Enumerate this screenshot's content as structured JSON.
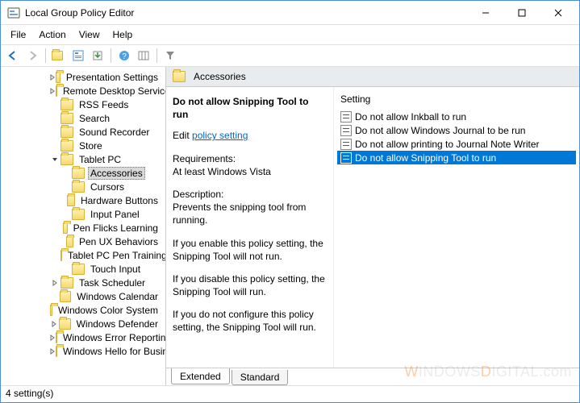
{
  "window": {
    "title": "Local Group Policy Editor"
  },
  "menu": {
    "items": [
      "File",
      "Action",
      "View",
      "Help"
    ]
  },
  "toolbar": {
    "back": "back-icon",
    "forward": "forward-icon",
    "up": "up-folder-icon",
    "props": "properties-icon",
    "export": "export-icon",
    "help": "help-icon",
    "cols": "columns-icon",
    "filter": "filter-icon"
  },
  "tree": {
    "items": [
      {
        "label": "Presentation Settings",
        "depth": 4,
        "toggle": ">"
      },
      {
        "label": "Remote Desktop Services",
        "depth": 4,
        "toggle": ">"
      },
      {
        "label": "RSS Feeds",
        "depth": 4,
        "toggle": ""
      },
      {
        "label": "Search",
        "depth": 4,
        "toggle": ""
      },
      {
        "label": "Sound Recorder",
        "depth": 4,
        "toggle": ""
      },
      {
        "label": "Store",
        "depth": 4,
        "toggle": ""
      },
      {
        "label": "Tablet PC",
        "depth": 4,
        "toggle": "v",
        "expanded": true
      },
      {
        "label": "Accessories",
        "depth": 5,
        "toggle": "",
        "selected": true
      },
      {
        "label": "Cursors",
        "depth": 5,
        "toggle": ""
      },
      {
        "label": "Hardware Buttons",
        "depth": 5,
        "toggle": ""
      },
      {
        "label": "Input Panel",
        "depth": 5,
        "toggle": ""
      },
      {
        "label": "Pen Flicks Learning",
        "depth": 5,
        "toggle": ""
      },
      {
        "label": "Pen UX Behaviors",
        "depth": 5,
        "toggle": ""
      },
      {
        "label": "Tablet PC Pen Training",
        "depth": 5,
        "toggle": ""
      },
      {
        "label": "Touch Input",
        "depth": 5,
        "toggle": ""
      },
      {
        "label": "Task Scheduler",
        "depth": 4,
        "toggle": ">"
      },
      {
        "label": "Windows Calendar",
        "depth": 4,
        "toggle": ""
      },
      {
        "label": "Windows Color System",
        "depth": 4,
        "toggle": ""
      },
      {
        "label": "Windows Defender",
        "depth": 4,
        "toggle": ">"
      },
      {
        "label": "Windows Error Reporting",
        "depth": 4,
        "toggle": ">"
      },
      {
        "label": "Windows Hello for Business",
        "depth": 4,
        "toggle": ">"
      }
    ]
  },
  "crumb": {
    "label": "Accessories"
  },
  "description": {
    "title": "Do not allow Snipping Tool to run",
    "edit_link": "policy setting",
    "edit_prefix": "Edit",
    "req_label": "Requirements:",
    "req_text": "At least Windows Vista",
    "desc_label": "Description:",
    "p1": "Prevents the snipping tool from running.",
    "p2": "If you enable this policy setting, the Snipping Tool will not run.",
    "p3": "If you disable this policy setting, the Snipping Tool will run.",
    "p4": "If you do not configure this policy setting, the Snipping Tool will run."
  },
  "list": {
    "header": "Setting",
    "items": [
      {
        "label": "Do not allow Inkball to run",
        "selected": false
      },
      {
        "label": "Do not allow Windows Journal to be run",
        "selected": false
      },
      {
        "label": "Do not allow printing to Journal Note Writer",
        "selected": false
      },
      {
        "label": "Do not allow Snipping Tool to run",
        "selected": true
      }
    ]
  },
  "tabs": {
    "extended": "Extended",
    "standard": "Standard"
  },
  "status": {
    "text": "4 setting(s)"
  },
  "watermark": {
    "part1": "W",
    "part2": "INDOWS",
    "part3": "D",
    "part4": "IGITAL.com"
  }
}
